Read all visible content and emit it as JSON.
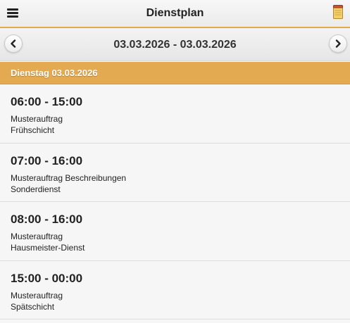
{
  "header": {
    "title": "Dienstplan",
    "menu_icon": "hamburger-menu-icon",
    "notes_icon": "notepad-icon"
  },
  "datebar": {
    "range": "03.03.2026 - 03.03.2026",
    "prev_icon": "chevron-left-icon",
    "next_icon": "chevron-right-icon"
  },
  "day": {
    "label": "Dienstag 03.03.2026",
    "accent_color": "#e3aa52"
  },
  "shifts": [
    {
      "time": "06:00 - 15:00",
      "order": "Musterauftrag",
      "shift": "Frühschicht"
    },
    {
      "time": "07:00 - 16:00",
      "order": "Musterauftrag Beschreibungen",
      "shift": "Sonderdienst"
    },
    {
      "time": "08:00 - 16:00",
      "order": "Musterauftrag",
      "shift": "Hausmeister-Dienst"
    },
    {
      "time": "15:00 - 00:00",
      "order": "Musterauftrag",
      "shift": "Spätschicht"
    }
  ]
}
